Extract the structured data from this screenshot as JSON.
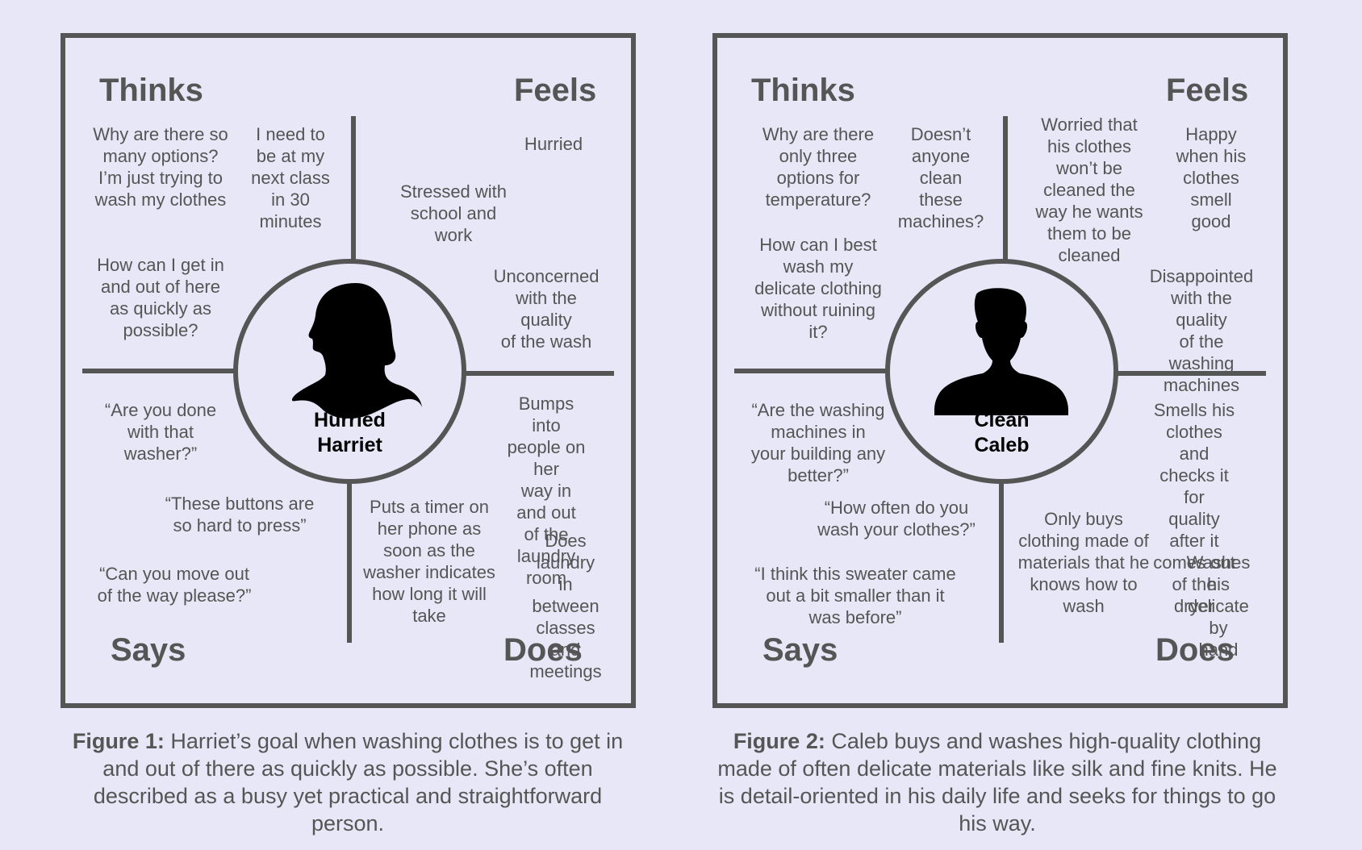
{
  "maps": [
    {
      "quadrants": {
        "thinks": "Thinks",
        "feels": "Feels",
        "says": "Says",
        "does": "Does"
      },
      "persona_name": "Hurried\nHarriet",
      "persona_icon": "woman-silhouette-icon",
      "thinks": [
        "Why are there so\nmany options?\nI’m just trying to\nwash my clothes",
        "I need to\nbe at my\nnext class\nin 30\nminutes",
        "How can I get in\nand out of here\nas quickly as\npossible?"
      ],
      "feels": [
        "Hurried",
        "Stressed with\nschool and\nwork",
        "Unconcerned\nwith the quality\nof the wash"
      ],
      "says": [
        "“Are you done\nwith that\nwasher?”",
        "“These buttons are\nso hard to press”",
        "“Can you move out\nof the way please?”"
      ],
      "does": [
        "Bumps into\npeople on her\nway in and out\nof the laundry\nroom",
        "Puts a timer on\nher phone as\nsoon as the\nwasher indicates\nhow long it will\ntake",
        "Does laundry\nin between\nclasses and\nmeetings"
      ],
      "caption_label": "Figure 1:",
      "caption_text": " Harriet’s goal when washing clothes is to get in and out of there as quickly as possible. She’s often described as a busy yet practical and straightforward person."
    },
    {
      "quadrants": {
        "thinks": "Thinks",
        "feels": "Feels",
        "says": "Says",
        "does": "Does"
      },
      "persona_name": "Clean\nCaleb",
      "persona_icon": "man-silhouette-icon",
      "thinks": [
        "Why are there\nonly three\noptions for\ntemperature?",
        "Doesn’t\nanyone\nclean\nthese\nmachines?",
        "How can I best\nwash my\ndelicate clothing\nwithout ruining\nit?"
      ],
      "feels": [
        "Worried that\nhis clothes\nwon’t be\ncleaned the\nway he wants\nthem to be\ncleaned",
        "Happy\nwhen his\nclothes\nsmell\ngood",
        "Disappointed\nwith the quality\nof the washing\nmachines"
      ],
      "says": [
        "“Are the washing\nmachines in\nyour building any\nbetter?”",
        "“How often do you\nwash your clothes?”",
        "“I think this sweater came\nout a bit smaller than it\nwas before”"
      ],
      "does": [
        "Smells his clothes\nand checks it for\nquality after it\ncomes out of the\ndryer",
        "Only buys\nclothing made of\nmaterials that he\nknows how to\nwash",
        "Washes his\ndelicate by\nhand"
      ],
      "caption_label": "Figure 2:",
      "caption_text": " Caleb buys and washes high-quality clothing made of often delicate materials like silk and fine knits. He is detail-oriented in his daily life and seeks for things to go his way."
    }
  ]
}
